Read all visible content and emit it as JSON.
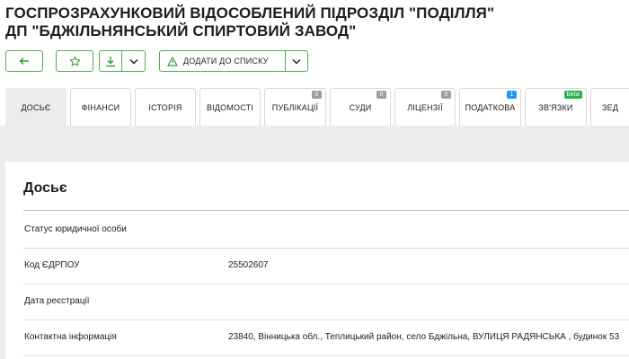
{
  "header": {
    "title_line1": "ГОСПРОЗРАХУНКОВИЙ ВІДОСОБЛЕНИЙ ПІДРОЗДІЛ \"ПОДІЛЛЯ\"",
    "title_line2": "ДП \"БДЖІЛЬНЯНСЬКИЙ СПИРТОВИЙ ЗАВОД\""
  },
  "toolbar": {
    "back_icon": "arrow-left-icon",
    "favorite_icon": "star-icon",
    "download_icon": "download-icon",
    "add_to_list_label": "ДОДАТИ ДО СПИСКУ",
    "add_to_list_icon": "triangle-alert-icon",
    "accent_color": "#2e9d3a"
  },
  "tabs": [
    {
      "label": "ДОСЬЄ",
      "active": true,
      "badge": ""
    },
    {
      "label": "ФІНАНСИ",
      "active": false,
      "badge": ""
    },
    {
      "label": "ІСТОРІЯ",
      "active": false,
      "badge": ""
    },
    {
      "label": "ВІДОМОСТІ",
      "active": false,
      "badge": ""
    },
    {
      "label": "ПУБЛІКАЦІЇ",
      "active": false,
      "badge": "0"
    },
    {
      "label": "СУДИ",
      "active": false,
      "badge": "0"
    },
    {
      "label": "ЛІЦЕНЗІЇ",
      "active": false,
      "badge": "0"
    },
    {
      "label": "ПОДАТКОВА",
      "active": false,
      "badge": "1"
    },
    {
      "label": "ЗВ'ЯЗКИ",
      "active": false,
      "badge": "beta"
    },
    {
      "label": "ЗЕД",
      "active": false,
      "badge": ""
    }
  ],
  "dossier": {
    "title": "Досьє",
    "rows": [
      {
        "label": "Статус юридичної особи",
        "value": ""
      },
      {
        "label": "Код ЄДРПОУ",
        "value": "25502607"
      },
      {
        "label": "Дата реєстрації",
        "value": ""
      },
      {
        "label": "Контактна інформація",
        "value": "23840, Вінницька обл., Теплицький район, село Бджільна, ВУЛИЦЯ РАДЯНСЬКА , будинок 53"
      }
    ]
  }
}
